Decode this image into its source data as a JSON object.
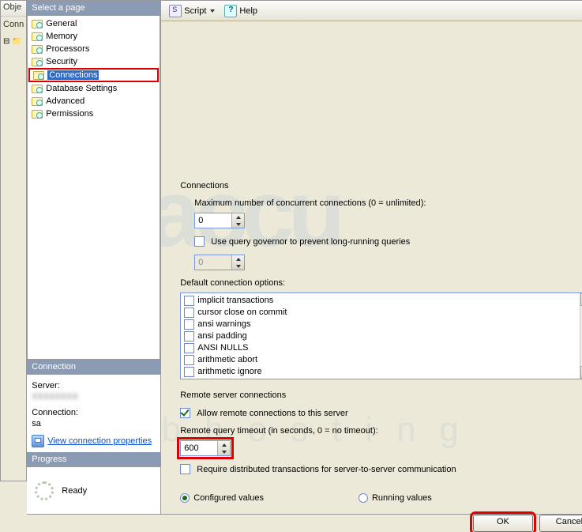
{
  "obj_panel": {
    "header": "Obje",
    "conn": "Conn"
  },
  "left": {
    "select_page": "Select a page",
    "pages": [
      "General",
      "Memory",
      "Processors",
      "Security",
      "Connections",
      "Database Settings",
      "Advanced",
      "Permissions"
    ],
    "selected_index": 4,
    "connection_header": "Connection",
    "server_label": "Server:",
    "server_value": "XXXXXXXX",
    "connection_label": "Connection:",
    "connection_value": "sa",
    "view_props": "View connection properties",
    "progress_header": "Progress",
    "progress_text": "Ready"
  },
  "toolbar": {
    "script": "Script",
    "help": "Help"
  },
  "form": {
    "connections_group": "Connections",
    "max_conn_label": "Maximum number of concurrent connections (0 = unlimited):",
    "max_conn_value": "0",
    "governor_label": "Use query governor to prevent long-running queries",
    "governor_value": "0",
    "default_opts_label": "Default connection options:",
    "options": [
      "implicit transactions",
      "cursor close on commit",
      "ansi warnings",
      "ansi padding",
      "ANSI NULLS",
      "arithmetic abort",
      "arithmetic ignore"
    ],
    "remote_group": "Remote server connections",
    "allow_remote": "Allow remote connections to this server",
    "remote_timeout_label": "Remote query timeout (in seconds, 0 = no timeout):",
    "remote_timeout_value": "600",
    "require_dist": "Require distributed transactions for server-to-server communication",
    "configured": "Configured values",
    "running": "Running values"
  },
  "buttons": {
    "ok": "OK",
    "cancel": "Cancel"
  }
}
